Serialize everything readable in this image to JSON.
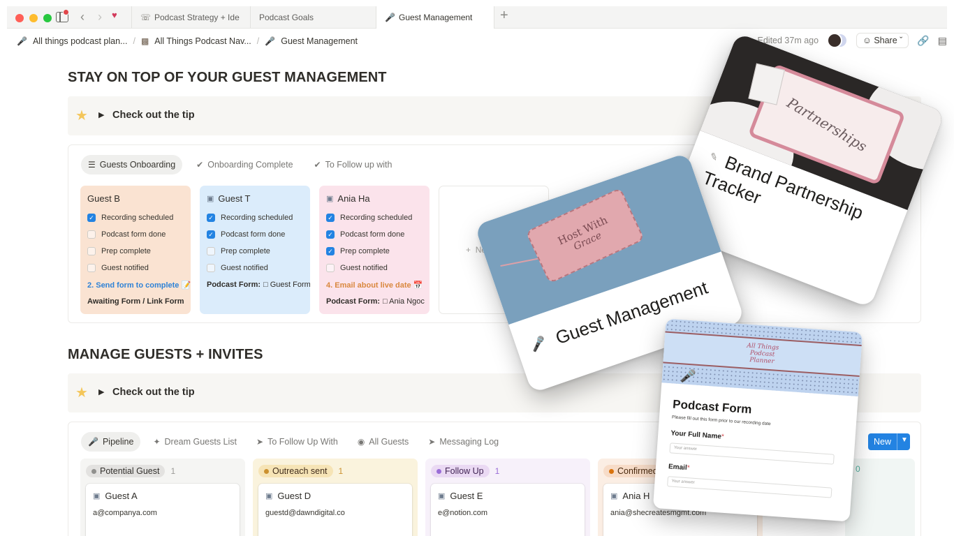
{
  "browser": {
    "tabs": [
      {
        "label": "Podcast Strategy + Ide",
        "icon": "podcast-icon"
      },
      {
        "label": "Podcast Goals",
        "icon": "none"
      },
      {
        "label": "Guest Management",
        "icon": "microphone-icon"
      }
    ],
    "new_tab": "+"
  },
  "header": {
    "breadcrumb": [
      "All things podcast plan...",
      "All Things Podcast Nav...",
      "Guest Management"
    ],
    "edited": "Edited 37m ago",
    "share_label": "Share"
  },
  "section1": {
    "title": "STAY ON TOP OF YOUR GUEST MANAGEMENT",
    "callout": "Check out the tip",
    "views": [
      "Guests Onboarding",
      "Onboarding Complete",
      "To Follow up with"
    ],
    "cards": [
      {
        "title": "Guest B",
        "checks": [
          {
            "label": "Recording scheduled",
            "checked": true
          },
          {
            "label": "Podcast form done",
            "checked": false
          },
          {
            "label": "Prep complete",
            "checked": false
          },
          {
            "label": "Guest notified",
            "checked": false
          }
        ],
        "step": "2. Send form to complete 📝",
        "footer": "Awaiting Form / Link Form",
        "footer_value": ""
      },
      {
        "title": "Guest T",
        "checks": [
          {
            "label": "Recording scheduled",
            "checked": true
          },
          {
            "label": "Podcast form done",
            "checked": true
          },
          {
            "label": "Prep complete",
            "checked": false
          },
          {
            "label": "Guest notified",
            "checked": false
          }
        ],
        "step": "",
        "footer": "Podcast Form:",
        "footer_value": "Guest Form"
      },
      {
        "title": "Ania Ha",
        "checks": [
          {
            "label": "Recording scheduled",
            "checked": true
          },
          {
            "label": "Podcast form done",
            "checked": true
          },
          {
            "label": "Prep complete",
            "checked": true
          },
          {
            "label": "Guest notified",
            "checked": false
          }
        ],
        "step": "4. Email about live date 📅",
        "footer": "Podcast Form:",
        "footer_value": "Ania Ngoc"
      }
    ],
    "new_card": "New"
  },
  "section2": {
    "title": "MANAGE GUESTS + INVITES",
    "callout": "Check out the tip",
    "views": [
      "Pipeline",
      "Dream Guests List",
      "To Follow Up With",
      "All Guests",
      "Messaging Log"
    ],
    "new_button": "New",
    "columns": [
      {
        "status": "Potential Guest",
        "count": "1",
        "card_title": "Guest A",
        "email": "a@companya.com"
      },
      {
        "status": "Outreach sent",
        "count": "1",
        "card_title": "Guest D",
        "email": "guestd@dawndigital.co"
      },
      {
        "status": "Follow Up",
        "count": "1",
        "card_title": "Guest E",
        "email": "e@notion.com"
      },
      {
        "status": "Confirmed",
        "count": "",
        "card_title": "Ania H",
        "email": "ania@shecreatesmgmt.com"
      }
    ],
    "hidden_count": "0"
  },
  "overlays": {
    "brand": {
      "title_line1": "Brand Partnership",
      "title_line2": "Tracker",
      "note_text": "Partnerships"
    },
    "guest": {
      "title": "Guest Management",
      "tag_line1": "Host With",
      "tag_line2": "Grace"
    },
    "form": {
      "title": "Podcast Form",
      "subtitle": "Please fill out this form prior to our recording date",
      "logo_text": "All Things Podcast Planner",
      "field1": "Your Full Name",
      "field2": "Email",
      "placeholder": "Your answer"
    }
  },
  "colors": {
    "accent": "#2383e2",
    "checkbox": "#2383e2",
    "star": "#f4c65a"
  }
}
